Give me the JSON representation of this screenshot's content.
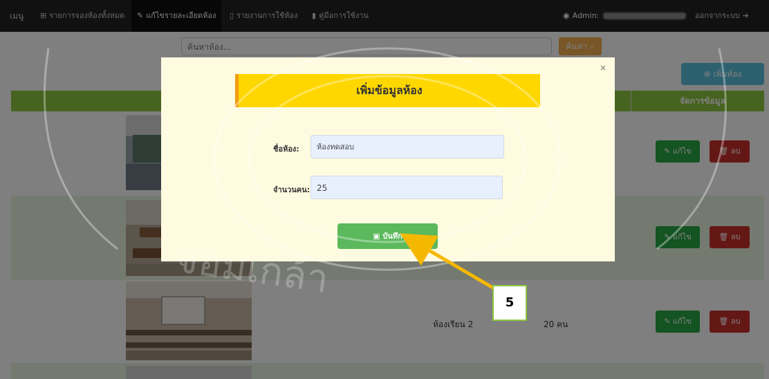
{
  "navbar": {
    "brand": "เมนู",
    "items": [
      {
        "label": "รายการจองห้องทั้งหมด"
      },
      {
        "label": "แก้ไขรายละเอียดห้อง"
      },
      {
        "label": "รายงานการใช้ห้อง"
      },
      {
        "label": "คู่มือการใช้งาน"
      }
    ],
    "admin_label": "Admin:",
    "logout_label": "ออกจากระบบ"
  },
  "search": {
    "placeholder": "ค้นหาห้อง...",
    "button_label": "ค้นหา"
  },
  "add_button_label": "เพิ่มห้อง",
  "table": {
    "headers": [
      "",
      "",
      "",
      "",
      "จัดการข้อมูล"
    ],
    "rows": [
      {
        "name": "",
        "capacity": ""
      },
      {
        "name": "",
        "capacity": ""
      },
      {
        "name": "ห้องเรียน 2",
        "capacity": "20 คน"
      }
    ],
    "edit_label": "แก้ไข",
    "delete_label": "ลบ"
  },
  "modal": {
    "title": "เพิ่มข้อมูลห้อง",
    "close": "×",
    "fields": {
      "room_name_label": "ชื่อห้อง:",
      "room_name_value": "ห้องทดสอบ",
      "capacity_label": "จำนวนคน:",
      "capacity_value": "25"
    },
    "save_label": "บันทึก"
  },
  "callout_step": "5",
  "colors": {
    "navbar": "#222222",
    "header_green": "#8dc63f",
    "add_button": "#5bc0de",
    "search_button": "#f0ad4e",
    "edit_button": "#28a745",
    "delete_button": "#c9302c",
    "modal_bg": "#fffbe0",
    "modal_title_bg": "#ffd700",
    "save_button": "#5cb85c",
    "arrow": "#f5b800"
  },
  "icons": [
    "table-icon",
    "edit-icon",
    "file-icon",
    "book-icon",
    "user-circle-icon",
    "logout-icon",
    "search-icon",
    "plus-circle-icon",
    "pencil-square-icon",
    "trash-icon",
    "floppy-disk-icon"
  ]
}
